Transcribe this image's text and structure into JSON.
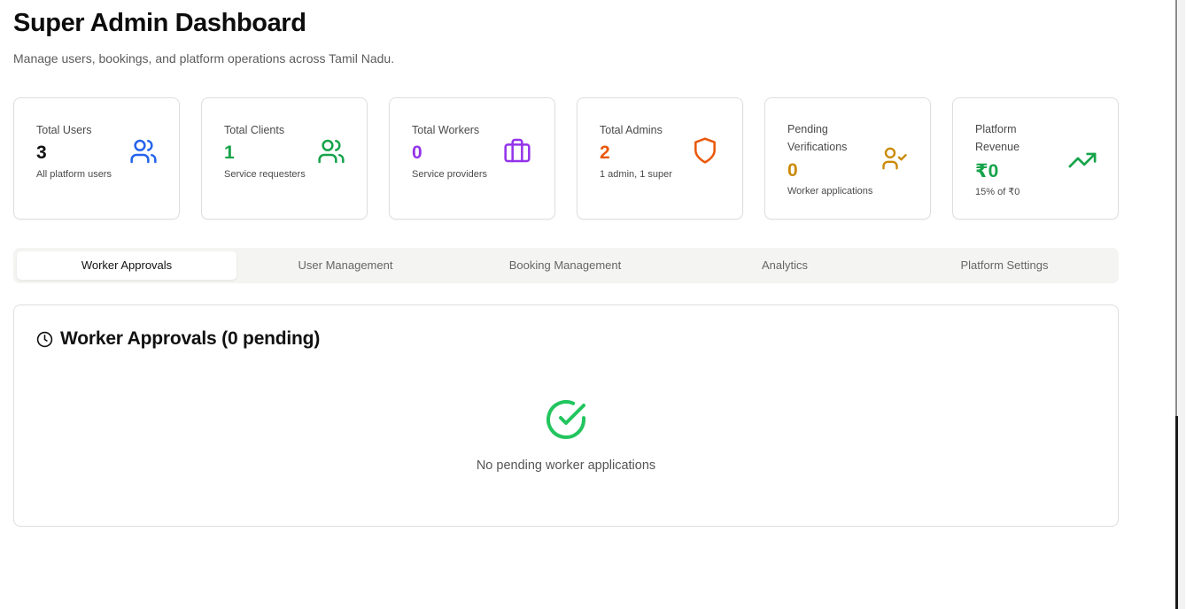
{
  "header": {
    "title": "Super Admin Dashboard",
    "subtitle": "Manage users, bookings, and platform operations across Tamil Nadu."
  },
  "stats": [
    {
      "label": "Total Users",
      "value": "3",
      "desc": "All platform users",
      "icon": "users-icon",
      "color": "#2563eb"
    },
    {
      "label": "Total Clients",
      "value": "1",
      "desc": "Service requesters",
      "icon": "users-icon",
      "color": "#16a34a"
    },
    {
      "label": "Total Workers",
      "value": "0",
      "desc": "Service providers",
      "icon": "briefcase-icon",
      "color": "#9333ea"
    },
    {
      "label": "Total Admins",
      "value": "2",
      "desc": "1 admin, 1 super",
      "icon": "shield-icon",
      "color": "#ea580c"
    },
    {
      "label_line1": "Pending",
      "label_line2": "Verifications",
      "value": "0",
      "desc": "Worker applications",
      "icon": "user-check-icon",
      "color": "#ca8a04"
    },
    {
      "label_line1": "Platform",
      "label_line2": "Revenue",
      "value": "₹0",
      "desc": "15% of ₹0",
      "icon": "trending-up-icon",
      "color": "#16a34a"
    }
  ],
  "tabs": [
    {
      "label": "Worker Approvals",
      "active": true
    },
    {
      "label": "User Management",
      "active": false
    },
    {
      "label": "Booking Management",
      "active": false
    },
    {
      "label": "Analytics",
      "active": false
    },
    {
      "label": "Platform Settings",
      "active": false
    }
  ],
  "panel": {
    "title": "Worker Approvals (0 pending)",
    "header_icon": "clock-icon",
    "empty_icon": "check-circle-icon",
    "empty_icon_color": "#22c55e",
    "empty_message": "No pending worker applications"
  }
}
